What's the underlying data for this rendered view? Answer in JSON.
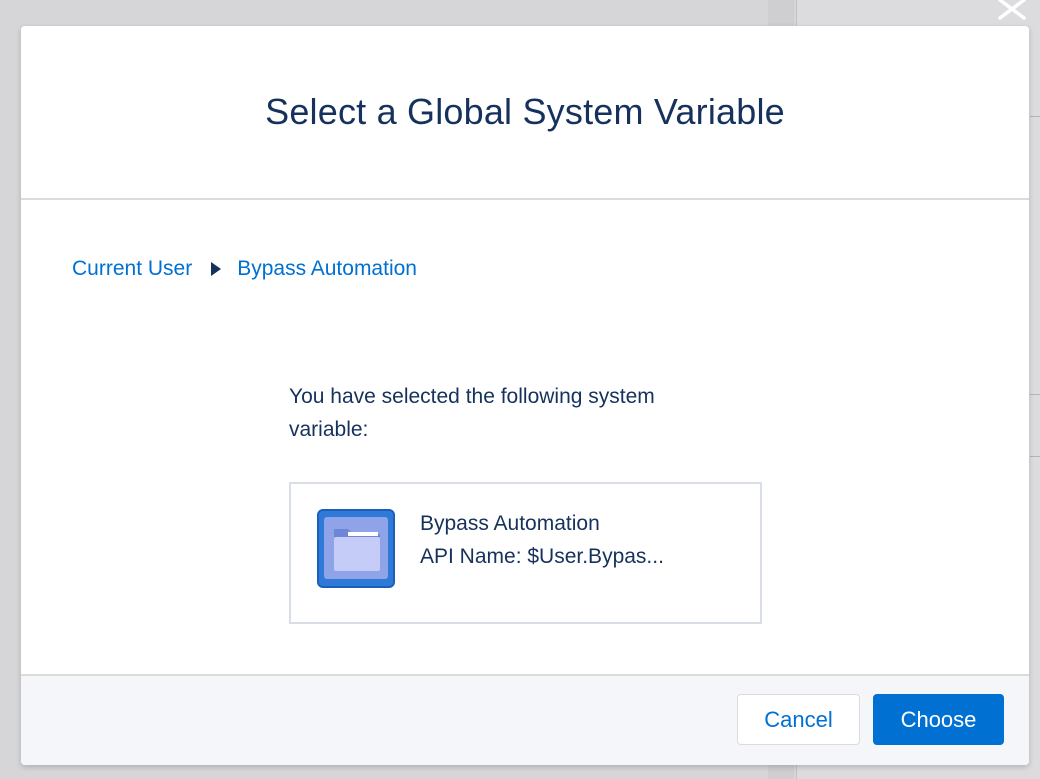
{
  "modal": {
    "title": "Select a Global System Variable"
  },
  "breadcrumb": {
    "items": [
      "Current User",
      "Bypass Automation"
    ]
  },
  "selection": {
    "message": "You have selected the following system variable:",
    "variable_name": "Bypass Automation",
    "api_name": "API Name: $User.Bypas..."
  },
  "footer": {
    "cancel_label": "Cancel",
    "choose_label": "Choose"
  },
  "icons": {
    "close": "close-icon",
    "folder": "folder-icon",
    "separator": "chevron-right-icon"
  },
  "colors": {
    "brand": "#0070d2",
    "title_text": "#16325c",
    "folder_tile": "#2f79d8"
  }
}
